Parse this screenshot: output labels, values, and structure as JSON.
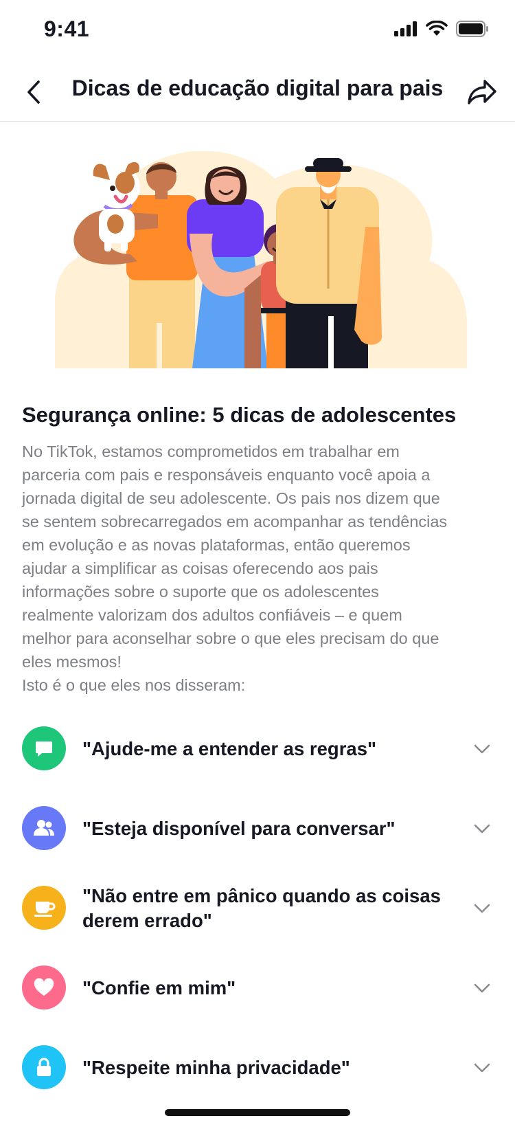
{
  "status_bar": {
    "time": "9:41"
  },
  "nav": {
    "title": "Dicas de educação digital para pais"
  },
  "article": {
    "title": "Segurança online: 5 dicas de adolescentes",
    "body_lines": [
      "No TikTok, estamos comprometidos em trabalhar em",
      "parceria com pais e responsáveis enquanto você apoia a",
      "jornada digital de seu adolescente. Os pais nos dizem que",
      "se sentem sobrecarregados em acompanhar as tendências",
      "em evolução e as novas plataformas, então queremos",
      "ajudar a simplificar as coisas oferecendo aos pais",
      "informações sobre o suporte que os adolescentes",
      "realmente valorizam dos adultos confiáveis – e quem",
      "melhor para aconselhar sobre o que eles precisam do que",
      "eles mesmos!",
      "Isto é o que eles nos disseram:"
    ]
  },
  "tips": [
    {
      "label": "\"Ajude-me a entender as regras\"",
      "icon": "chat-bubble-icon",
      "color": "#1ec67a"
    },
    {
      "label": "\"Esteja disponível para conversar\"",
      "icon": "people-icon",
      "color": "#6879f8"
    },
    {
      "label": "\"Não entre em pânico quando as coisas derem errado\"",
      "icon": "coffee-cup-icon",
      "color": "#f7b21b"
    },
    {
      "label": "\"Confie em mim\"",
      "icon": "heart-icon",
      "color": "#fe6a8b"
    },
    {
      "label": "\"Respeite minha privacidade\"",
      "icon": "lock-icon",
      "color": "#1fc3f5"
    }
  ]
}
